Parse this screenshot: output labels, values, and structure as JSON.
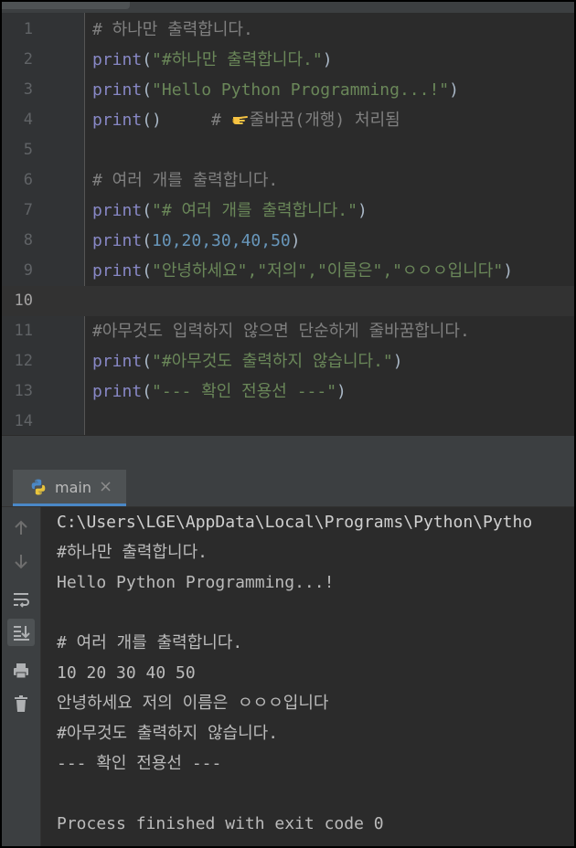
{
  "editor": {
    "lines": [
      {
        "n": "1",
        "segments": [
          {
            "t": "# 하나만 출력합니다.",
            "c": "cmt"
          }
        ]
      },
      {
        "n": "2",
        "segments": [
          {
            "t": "print",
            "c": "kw"
          },
          {
            "t": "(",
            "c": "p"
          },
          {
            "t": "\"#하나만 출력합니다.\"",
            "c": "str"
          },
          {
            "t": ")",
            "c": "p"
          }
        ]
      },
      {
        "n": "3",
        "segments": [
          {
            "t": "print",
            "c": "kw"
          },
          {
            "t": "(",
            "c": "p"
          },
          {
            "t": "\"Hello Python Programming...!\"",
            "c": "str"
          },
          {
            "t": ")",
            "c": "p"
          }
        ]
      },
      {
        "n": "4",
        "segments": [
          {
            "t": "print",
            "c": "kw"
          },
          {
            "t": "()     ",
            "c": "p"
          },
          {
            "t": "# ",
            "c": "cmt"
          },
          {
            "t": "줄바꿈(개행) 처리됨",
            "c": "cmt"
          }
        ]
      },
      {
        "n": "5",
        "segments": []
      },
      {
        "n": "6",
        "segments": [
          {
            "t": "# 여러 개를 출력합니다.",
            "c": "cmt"
          }
        ]
      },
      {
        "n": "7",
        "segments": [
          {
            "t": "print",
            "c": "kw"
          },
          {
            "t": "(",
            "c": "p"
          },
          {
            "t": "\"# 여러 개를 출력합니다.\"",
            "c": "str"
          },
          {
            "t": ")",
            "c": "p"
          }
        ]
      },
      {
        "n": "8",
        "segments": [
          {
            "t": "print",
            "c": "kw"
          },
          {
            "t": "(",
            "c": "p"
          },
          {
            "t": "10,20,30,40,50",
            "c": "num"
          },
          {
            "t": ")",
            "c": "p"
          }
        ]
      },
      {
        "n": "9",
        "segments": [
          {
            "t": "print",
            "c": "kw"
          },
          {
            "t": "(",
            "c": "p"
          },
          {
            "t": "\"안녕하세요\",\"저의\",\"이름은\",\"ㅇㅇㅇ입니다\"",
            "c": "str"
          },
          {
            "t": ")",
            "c": "p"
          }
        ]
      },
      {
        "n": "10",
        "segments": []
      },
      {
        "n": "11",
        "segments": [
          {
            "t": "#아무것도 입력하지 않으면 단순하게 줄바꿈합니다.",
            "c": "cmt"
          }
        ]
      },
      {
        "n": "12",
        "segments": [
          {
            "t": "print",
            "c": "kw"
          },
          {
            "t": "(",
            "c": "p"
          },
          {
            "t": "\"#아무것도 출력하지 않습니다.\"",
            "c": "str"
          },
          {
            "t": ")",
            "c": "p"
          }
        ]
      },
      {
        "n": "13",
        "segments": [
          {
            "t": "print",
            "c": "kw"
          },
          {
            "t": "(",
            "c": "p"
          },
          {
            "t": "\"--- 확인 전용선 ---\"",
            "c": "str"
          },
          {
            "t": ")",
            "c": "p"
          }
        ]
      },
      {
        "n": "14",
        "segments": []
      }
    ],
    "current_line": "10",
    "hand_icon": "pointing-hand-icon"
  },
  "run_panel": {
    "tab_label": "main",
    "tab_close": "×",
    "tools": [
      "up-arrow-icon",
      "down-arrow-icon",
      "soft-wrap-icon",
      "scroll-to-end-icon",
      "print-icon",
      "trash-icon"
    ],
    "console_lines": [
      "C:\\Users\\LGE\\AppData\\Local\\Programs\\Python\\Pytho",
      "#하나만 출력합니다.",
      "Hello Python Programming...!",
      "",
      "# 여러 개를 출력합니다.",
      "10 20 30 40 50",
      "안녕하세요 저의 이름은 ㅇㅇㅇ입니다",
      "#아무것도 출력하지 않습니다.",
      "--- 확인 전용선 ---",
      "",
      "Process finished with exit code 0"
    ]
  },
  "colors": {
    "background": "#2b2b2b",
    "keyword": "#8888c6",
    "string": "#6a8759",
    "number": "#6897bb",
    "comment": "#808080",
    "accent": "#4a88c7"
  }
}
